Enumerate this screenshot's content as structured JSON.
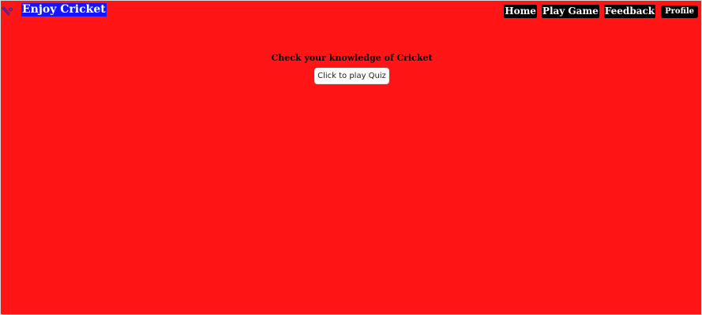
{
  "header": {
    "logo_icon": "cricket-bat-icon",
    "title": "Enjoy Cricket"
  },
  "nav": {
    "home": "Home",
    "play_game": "Play Game",
    "feedback": "Feedback",
    "profile": "Profile"
  },
  "main": {
    "prompt": "Check your knowledge of Cricket",
    "quiz_button": "Click to play Quiz"
  },
  "colors": {
    "background": "#ff1515",
    "title_background": "#1515ff",
    "nav_background": "#000000",
    "logo_icon": "#2a2ab0"
  }
}
